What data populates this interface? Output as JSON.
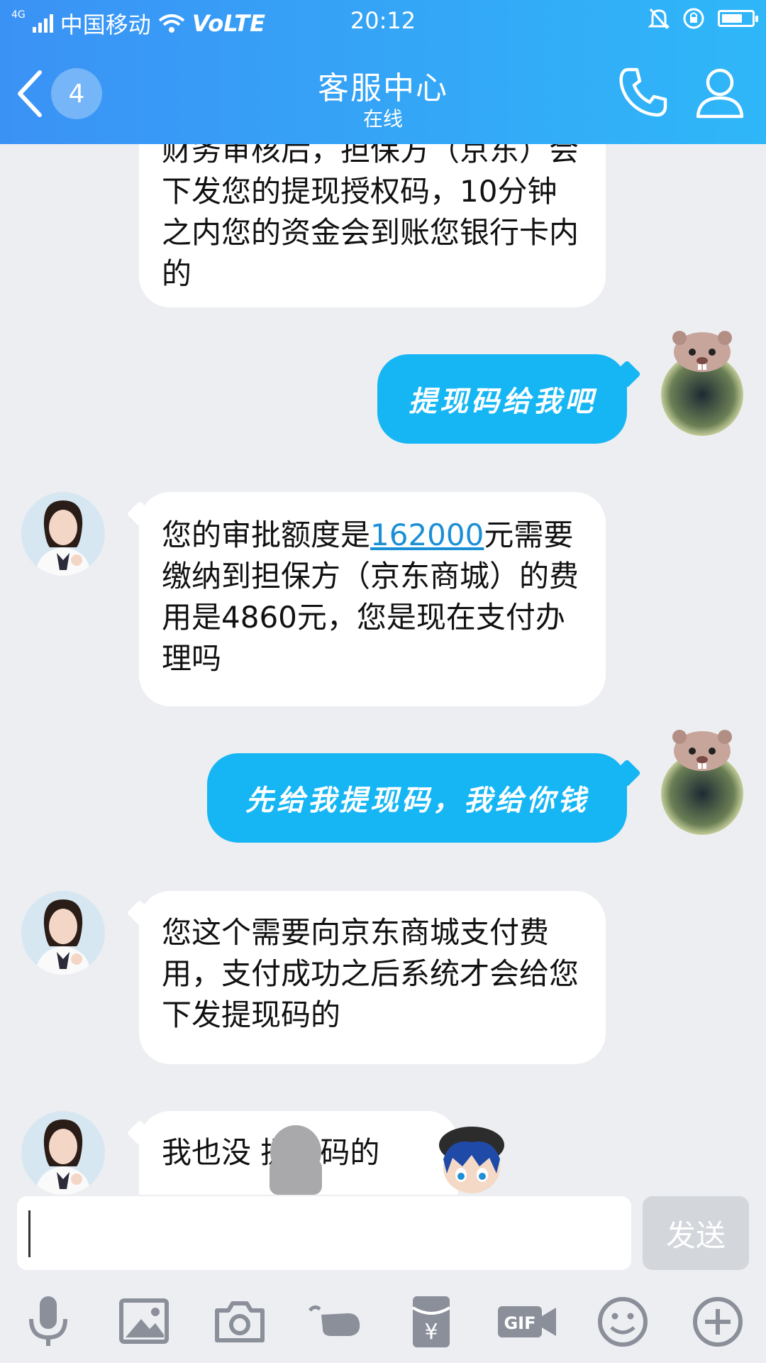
{
  "status_bar": {
    "network": "4G",
    "carrier": "中国移动",
    "volte": "VoLTE",
    "time": "20:12",
    "battery_level": 0.7
  },
  "header": {
    "unread_count": "4",
    "title": "客服中心",
    "subtitle": "在线"
  },
  "messages": [
    {
      "from": "agent",
      "text": "财务审核后，担保方（京东）会下发您的提现授权码，10分钟之内您的资金会到账您银行卡内的"
    },
    {
      "from": "user",
      "text": "提现码给我吧"
    },
    {
      "from": "agent",
      "text_before": "您的审批额度是",
      "link": "162000",
      "text_after": "元需要缴纳到担保方（京东商城）的费用是4860元，您是现在支付办理吗"
    },
    {
      "from": "user",
      "text": "先给我提现码，我给你钱"
    },
    {
      "from": "agent",
      "text": "您这个需要向京东商城支付费用，支付成功之后系统才会给您下发提现码的"
    },
    {
      "from": "agent",
      "text": "我也没 提现码的"
    }
  ],
  "input": {
    "placeholder": "",
    "send_label": "发送"
  },
  "toolbar": {
    "icons": [
      "microphone-icon",
      "image-icon",
      "camera-icon",
      "poke-icon",
      "red-packet-icon",
      "gif-icon",
      "emoji-icon",
      "plus-icon"
    ],
    "gif_label": "GIF",
    "red_packet_label": "¥"
  },
  "colors": {
    "header_start": "#3b92f5",
    "header_end": "#2fb7f8",
    "user_bubble": "#16b6f4",
    "link": "#1b8fd6",
    "background": "#edeef2"
  }
}
